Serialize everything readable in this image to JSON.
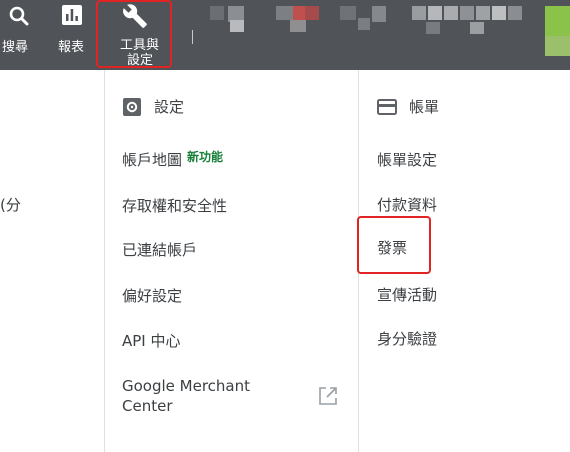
{
  "toolbar": {
    "search_label": "搜尋",
    "reports_label": "報表",
    "tools_label_line1": "工具與",
    "tools_label_line2": "設定"
  },
  "left_fragment": "(分",
  "settings": {
    "header": "設定",
    "icon": "gear-icon",
    "items": [
      {
        "label": "帳戶地圖",
        "badge": "新功能"
      },
      {
        "label": "存取權和安全性"
      },
      {
        "label": "已連結帳戶"
      },
      {
        "label": "偏好設定"
      },
      {
        "label": "API 中心"
      },
      {
        "label": "Google Merchant Center",
        "icon": "open-in-new-icon"
      }
    ]
  },
  "billing": {
    "header": "帳單",
    "icon": "credit-card-icon",
    "items": [
      {
        "label": "帳單設定"
      },
      {
        "label": "付款資料"
      },
      {
        "label": "發票"
      },
      {
        "label": "宣傳活動"
      },
      {
        "label": "身分驗證"
      }
    ]
  },
  "colors": {
    "topbar": "#505357",
    "highlight": "#e02424",
    "badge": "#188038",
    "text": "#3c4043"
  }
}
